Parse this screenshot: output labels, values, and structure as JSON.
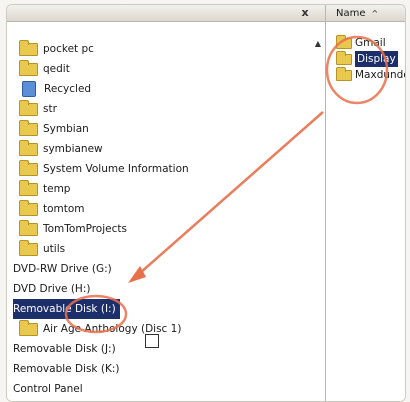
{
  "tree": {
    "items": [
      {
        "label": "pocket pc",
        "icon": "folder",
        "indent": true
      },
      {
        "label": "qedit",
        "icon": "folder",
        "indent": true
      },
      {
        "label": "Recycled",
        "icon": "recycle-bin",
        "indent": true
      },
      {
        "label": "str",
        "icon": "folder",
        "indent": true
      },
      {
        "label": "Symbian",
        "icon": "folder",
        "indent": true
      },
      {
        "label": "symbianew",
        "icon": "folder",
        "indent": true
      },
      {
        "label": "System Volume Information",
        "icon": "folder",
        "indent": true
      },
      {
        "label": "temp",
        "icon": "folder",
        "indent": true
      },
      {
        "label": "tomtom",
        "icon": "folder",
        "indent": true
      },
      {
        "label": "TomTomProjects",
        "icon": "folder",
        "indent": true
      },
      {
        "label": "utils",
        "icon": "folder",
        "indent": true
      },
      {
        "label": "DVD-RW Drive (G:)",
        "icon": "none",
        "indent": false
      },
      {
        "label": "DVD Drive (H:)",
        "icon": "none",
        "indent": false
      },
      {
        "label": "Removable Disk (I:)",
        "icon": "none",
        "indent": false,
        "selected": true
      },
      {
        "label": "Air Age Anthology (Disc 1)",
        "icon": "folder",
        "indent": true
      },
      {
        "label": "Removable Disk (J:)",
        "icon": "none",
        "indent": false
      },
      {
        "label": "Removable Disk (K:)",
        "icon": "none",
        "indent": false
      },
      {
        "label": "Control Panel",
        "icon": "none",
        "indent": false
      }
    ]
  },
  "right_pane": {
    "column_header": "Name",
    "sort_indicator": "^",
    "items": [
      {
        "label": "Gmail",
        "selected": false
      },
      {
        "label": "Display",
        "selected": true
      },
      {
        "label": "Maxdundo",
        "selected": false
      }
    ]
  },
  "window": {
    "close_glyph": "x",
    "scroll_glyph": "▲"
  },
  "annotation": {
    "color": "#e8704a"
  }
}
